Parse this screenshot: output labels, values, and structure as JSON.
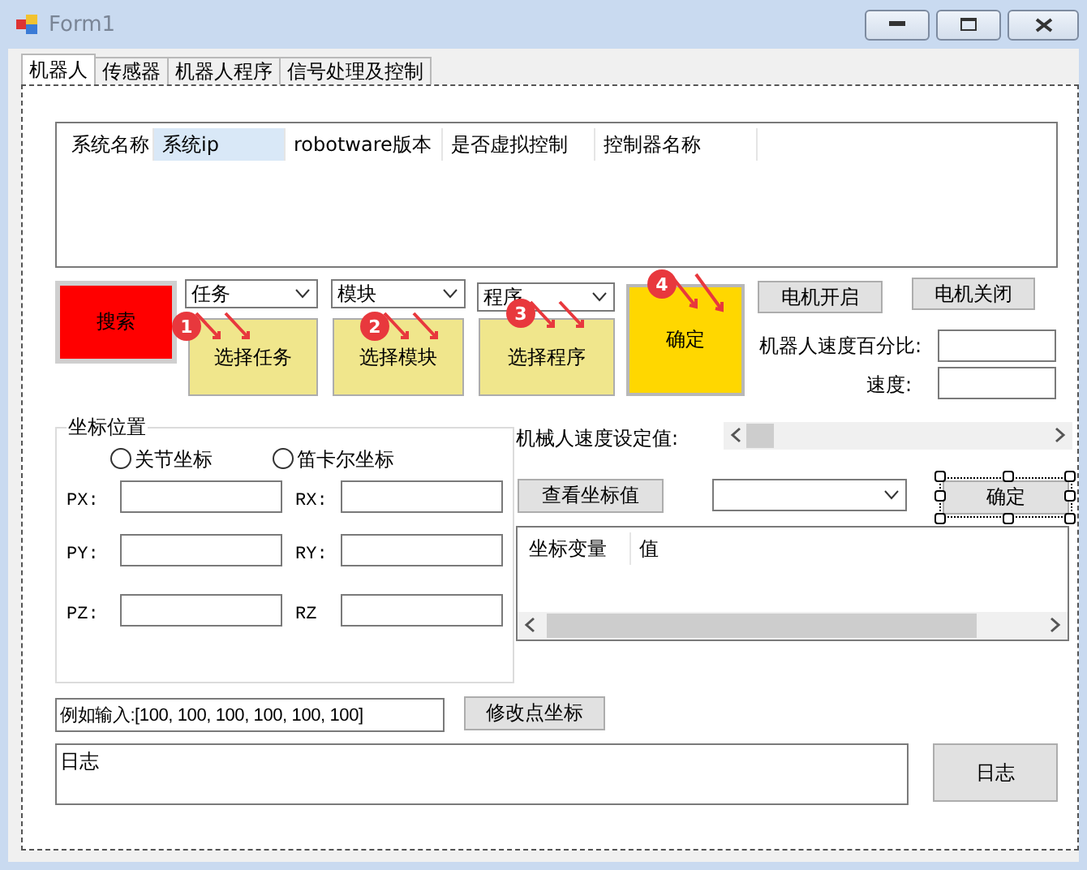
{
  "window": {
    "title": "Form1"
  },
  "tabs": [
    {
      "label": "机器人",
      "selected": true
    },
    {
      "label": "传感器",
      "selected": false
    },
    {
      "label": "机器人程序",
      "selected": false
    },
    {
      "label": "信号处理及控制",
      "selected": false
    }
  ],
  "system_list": {
    "columns": [
      {
        "label": "系统名称",
        "highlighted": false
      },
      {
        "label": "系统ip",
        "highlighted": true
      },
      {
        "label": "robotware版本",
        "highlighted": false
      },
      {
        "label": "是否虚拟控制",
        "highlighted": false
      },
      {
        "label": "控制器名称",
        "highlighted": false
      }
    ]
  },
  "search_button": "搜索",
  "selectors": [
    {
      "dropdown": "任务",
      "button": "选择任务"
    },
    {
      "dropdown": "模块",
      "button": "选择模块"
    },
    {
      "dropdown": "程序",
      "button": "选择程序"
    }
  ],
  "confirm_button": "确定",
  "motor_buttons": [
    "电机开启",
    "电机关闭"
  ],
  "speed_fields": [
    {
      "label": "机器人速度百分比:"
    },
    {
      "label": "速度:"
    }
  ],
  "coordinate_group": {
    "title": "坐标位置",
    "modes": [
      {
        "label": "关节坐标",
        "selected": false
      },
      {
        "label": "笛卡尔坐标",
        "selected": false
      }
    ],
    "fields": [
      {
        "label": "PX:"
      },
      {
        "label": "RX:"
      },
      {
        "label": "PY:"
      },
      {
        "label": "RY:"
      },
      {
        "label": "PZ:"
      },
      {
        "label": "RZ"
      }
    ]
  },
  "speed_setting": {
    "label": "机械人速度设定值:"
  },
  "view_button": "查看坐标值",
  "ok_button": {
    "label": "确定",
    "designer_selected": true
  },
  "coordinate_list": {
    "columns": [
      "坐标变量",
      "值"
    ]
  },
  "example_input": {
    "value": "例如输入:[100, 100, 100, 100, 100, 100]"
  },
  "modify_button": "修改点坐标",
  "log": {
    "value": "日志"
  },
  "log_button": "日志",
  "annotations": [
    {
      "label": "1"
    },
    {
      "label": "2"
    },
    {
      "label": "3"
    },
    {
      "label": "4"
    }
  ]
}
